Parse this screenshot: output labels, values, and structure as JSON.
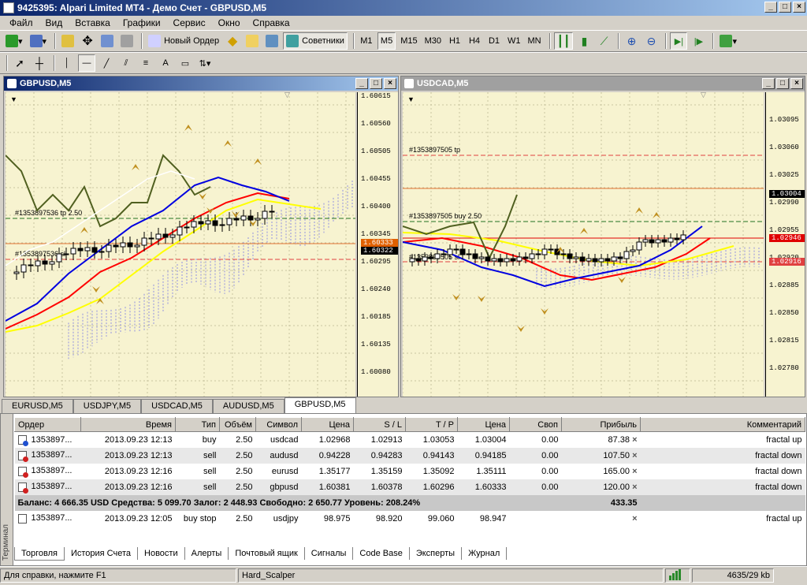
{
  "window": {
    "title": "9425395: Alpari Limited MT4 - Демо Счет - GBPUSD,M5"
  },
  "menu": [
    "Файл",
    "Вид",
    "Вставка",
    "Графики",
    "Сервис",
    "Окно",
    "Справка"
  ],
  "toolbar": {
    "new_order": "Новый Ордер",
    "advisors": "Советники",
    "timeframes": [
      "M1",
      "M5",
      "M15",
      "M30",
      "H1",
      "H4",
      "D1",
      "W1",
      "MN"
    ],
    "active_timeframe": "M5",
    "text_tool": "A"
  },
  "charts": {
    "left": {
      "title": "GBPUSD,M5",
      "prices": [
        "1.60615",
        "1.60560",
        "1.60505",
        "1.60455",
        "1.60400",
        "1.60345",
        "1.60295",
        "1.60240",
        "1.60185",
        "1.60135",
        "1.60080"
      ],
      "current_price": "1.60322",
      "marker_price": "1.60333",
      "labels": [
        "#1353897536 sl",
        "#1353897536 tp",
        "2.50"
      ]
    },
    "right": {
      "title": "USDCAD,M5",
      "prices": [
        "1.03095",
        "1.03060",
        "1.03025",
        "1.02990",
        "1.02955",
        "1.02920",
        "1.02885",
        "1.02850",
        "1.02815",
        "1.02780"
      ],
      "current_price": "1.03004",
      "stop_price": "1.02946",
      "price_3": "1.02916",
      "labels": [
        "#1353897505 tp",
        "#1353897505 buy 2.50",
        "#1353897505 sl"
      ]
    }
  },
  "chart_tabs": [
    "EURUSD,M5",
    "USDJPY,M5",
    "USDCAD,M5",
    "AUDUSD,M5",
    "GBPUSD,M5"
  ],
  "active_chart_tab": "GBPUSD,M5",
  "terminal": {
    "side_label": "Терминал",
    "columns": [
      "Ордер",
      "Время",
      "Тип",
      "Объём",
      "Символ",
      "Цена",
      "S / L",
      "T / P",
      "Цена",
      "Своп",
      "Прибыль",
      "Комментарий"
    ],
    "orders": [
      {
        "order": "1353897...",
        "time": "2013.09.23 12:13",
        "type": "buy",
        "volume": "2.50",
        "symbol": "usdcad",
        "price": "1.02968",
        "sl": "1.02913",
        "tp": "1.03053",
        "cur": "1.03004",
        "swap": "0.00",
        "profit": "87.38",
        "comment": "fractal up",
        "kind": "buy"
      },
      {
        "order": "1353897...",
        "time": "2013.09.23 12:13",
        "type": "sell",
        "volume": "2.50",
        "symbol": "audusd",
        "price": "0.94228",
        "sl": "0.94283",
        "tp": "0.94143",
        "cur": "0.94185",
        "swap": "0.00",
        "profit": "107.50",
        "comment": "fractal down",
        "kind": "sell"
      },
      {
        "order": "1353897...",
        "time": "2013.09.23 12:16",
        "type": "sell",
        "volume": "2.50",
        "symbol": "eurusd",
        "price": "1.35177",
        "sl": "1.35159",
        "tp": "1.35092",
        "cur": "1.35111",
        "swap": "0.00",
        "profit": "165.00",
        "comment": "fractal down",
        "kind": "sell"
      },
      {
        "order": "1353897...",
        "time": "2013.09.23 12:16",
        "type": "sell",
        "volume": "2.50",
        "symbol": "gbpusd",
        "price": "1.60381",
        "sl": "1.60378",
        "tp": "1.60296",
        "cur": "1.60333",
        "swap": "0.00",
        "profit": "120.00",
        "comment": "fractal down",
        "kind": "sell"
      }
    ],
    "balance_text": "Баланс: 4 666.35 USD  Средства: 5 099.70  Залог: 2 448.93  Свободно: 2 650.77  Уровень: 208.24%",
    "balance_total": "433.35",
    "pending": {
      "order": "1353897...",
      "time": "2013.09.23 12:05",
      "type": "buy stop",
      "volume": "2.50",
      "symbol": "usdjpy",
      "price": "98.975",
      "sl": "98.920",
      "tp": "99.060",
      "cur": "98.947",
      "comment": "fractal up"
    },
    "tabs": [
      "Торговля",
      "История Счета",
      "Новости",
      "Алерты",
      "Почтовый ящик",
      "Сигналы",
      "Code Base",
      "Эксперты",
      "Журнал"
    ],
    "active_tab": "Торговля"
  },
  "status": {
    "help": "Для справки, нажмите F1",
    "profile": "Hard_Scalper",
    "traffic": "4635/29 kb"
  },
  "colors": {
    "chart_bg": "#f7f3d0",
    "ma_red": "#e00000",
    "ma_blue": "#0020e0",
    "ma_yellow": "#ffff00",
    "cloud": "#9090e0"
  }
}
